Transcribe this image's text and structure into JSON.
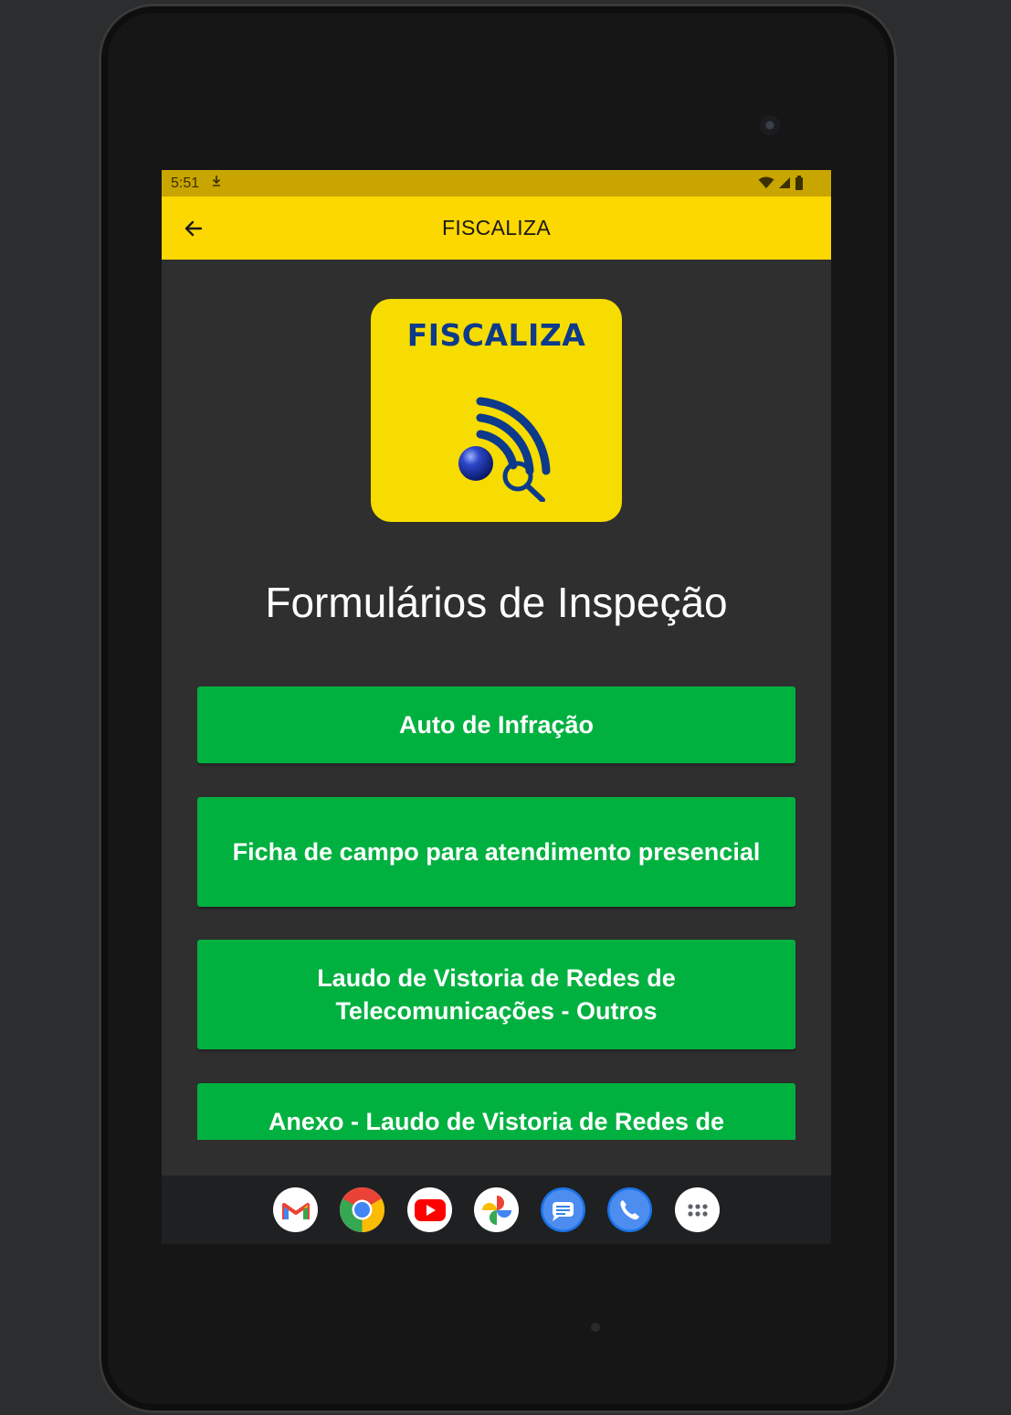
{
  "status_bar": {
    "time": "5:51"
  },
  "app_bar": {
    "title": "FISCALIZA"
  },
  "logo": {
    "text": "FISCALIZA"
  },
  "page": {
    "title": "Formulários de Inspeção"
  },
  "forms": [
    {
      "label": "Auto de Infração"
    },
    {
      "label": "Ficha de campo para atendimento presencial"
    },
    {
      "label": "Laudo de Vistoria de Redes de Telecomunicações - Outros"
    },
    {
      "label": "Anexo - Laudo de Vistoria de Redes de"
    }
  ],
  "dock": {
    "apps": [
      "gmail-icon",
      "chrome-icon",
      "youtube-icon",
      "photos-icon",
      "messages-icon",
      "phone-icon",
      "app-drawer-icon"
    ]
  },
  "colors": {
    "status_bar": "#c9a500",
    "app_bar": "#fdd700",
    "background": "#2f2f2f",
    "button": "#00b140",
    "logo_bg": "#f6dc00",
    "logo_text": "#0d3a8a"
  }
}
